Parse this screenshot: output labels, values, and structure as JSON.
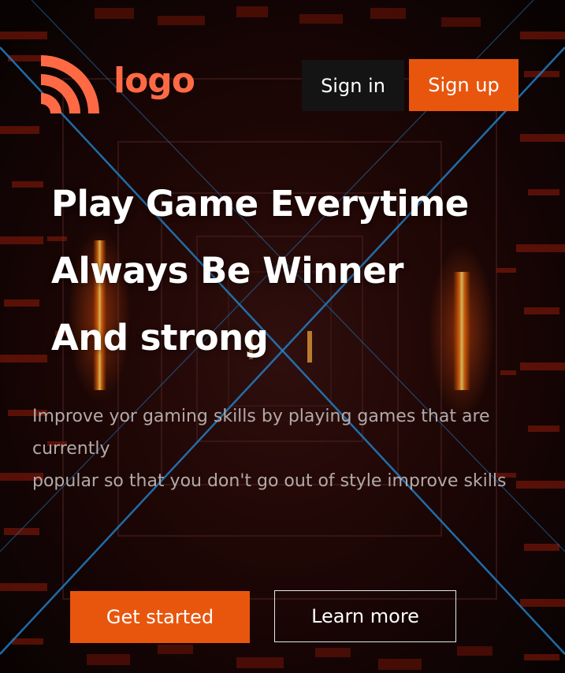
{
  "header": {
    "logo_text": "logo",
    "logo_icon": "rss-feed-icon",
    "sign_in_label": "Sign in",
    "sign_up_label": "Sign up"
  },
  "hero": {
    "title_lines": [
      "Play Game Everytime",
      "Always Be Winner",
      "And strong"
    ],
    "description_lines": [
      "Improve yor gaming skills by playing games that are",
      "currently",
      "popular so that you don't go out of style improve skills"
    ],
    "get_started_label": "Get started",
    "learn_more_label": "Learn more"
  },
  "colors": {
    "accent": "#e8560e",
    "logo": "#ff6a45",
    "sign_in_bg": "#141414",
    "background": "#0b0404"
  }
}
